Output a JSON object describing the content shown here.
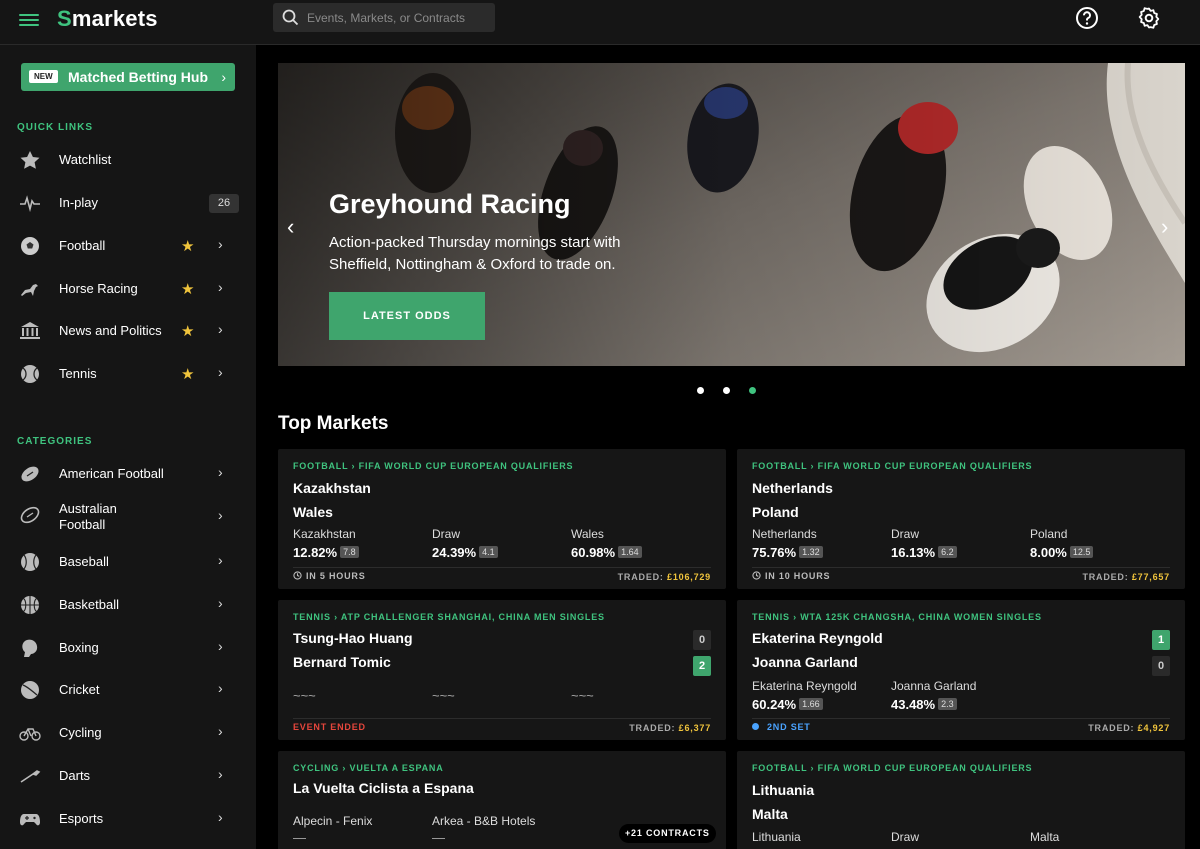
{
  "header": {
    "logo_text": "markets",
    "logo_s": "S",
    "search_placeholder": "Events, Markets, or Contracts",
    "help_icon": "help-icon",
    "settings_icon": "gear-icon"
  },
  "sidebar": {
    "hub_button": {
      "badge": "NEW",
      "label": "Matched Betting Hub"
    },
    "quick_links_title": "QUICK LINKS",
    "quick_links": [
      {
        "label": "Watchlist",
        "icon": "star-icon",
        "starred": false,
        "chevron": false
      },
      {
        "label": "In-play",
        "icon": "pulse-icon",
        "count": "26"
      },
      {
        "label": "Football",
        "icon": "football-icon",
        "starred": true,
        "chevron": true
      },
      {
        "label": "Horse Racing",
        "icon": "horse-icon",
        "starred": true,
        "chevron": true
      },
      {
        "label": "News and Politics",
        "icon": "parliament-icon",
        "starred": true,
        "chevron": true
      },
      {
        "label": "Tennis",
        "icon": "tennis-ball-icon",
        "starred": true,
        "chevron": true
      }
    ],
    "categories_title": "CATEGORIES",
    "categories": [
      {
        "label": "American Football",
        "icon": "american-football-icon"
      },
      {
        "label": "Australian Football",
        "line1": "Australian",
        "line2": "Football",
        "icon": "aussie-rules-icon"
      },
      {
        "label": "Baseball",
        "icon": "baseball-icon"
      },
      {
        "label": "Basketball",
        "icon": "basketball-icon"
      },
      {
        "label": "Boxing",
        "icon": "boxing-glove-icon"
      },
      {
        "label": "Cricket",
        "icon": "cricket-ball-icon"
      },
      {
        "label": "Cycling",
        "icon": "bicycle-icon"
      },
      {
        "label": "Darts",
        "icon": "dart-icon"
      },
      {
        "label": "Esports",
        "icon": "gamepad-icon"
      }
    ]
  },
  "banner": {
    "title": "Greyhound Racing",
    "description": "Action-packed Thursday mornings start with Sheffield, Nottingham & Oxford to trade on.",
    "cta": "LATEST ODDS",
    "slides": 3,
    "active_slide": 3
  },
  "top_markets": {
    "title": "Top Markets",
    "cards": [
      {
        "crumb_sport": "FOOTBALL",
        "crumb_comp": "FIFA WORLD CUP EUROPEAN QUALIFIERS",
        "team1": "Kazakhstan",
        "team2": "Wales",
        "outcomes": [
          {
            "name": "Kazakhstan",
            "pct": "12.82%",
            "odds": "7.8"
          },
          {
            "name": "Draw",
            "pct": "24.39%",
            "odds": "4.1"
          },
          {
            "name": "Wales",
            "pct": "60.98%",
            "odds": "1.64"
          }
        ],
        "status": "IN 5 HOURS",
        "traded_label": "TRADED:",
        "traded": "£106,729"
      },
      {
        "crumb_sport": "FOOTBALL",
        "crumb_comp": "FIFA WORLD CUP EUROPEAN QUALIFIERS",
        "team1": "Netherlands",
        "team2": "Poland",
        "outcomes": [
          {
            "name": "Netherlands",
            "pct": "75.76%",
            "odds": "1.32"
          },
          {
            "name": "Draw",
            "pct": "16.13%",
            "odds": "6.2"
          },
          {
            "name": "Poland",
            "pct": "8.00%",
            "odds": "12.5"
          }
        ],
        "status": "IN 10 HOURS",
        "traded_label": "TRADED:",
        "traded": "£77,657"
      },
      {
        "crumb_sport": "TENNIS",
        "crumb_comp": "ATP CHALLENGER SHANGHAI, CHINA MEN SINGLES",
        "team1": "Tsung-Hao Huang",
        "team2": "Bernard Tomic",
        "score1": "0",
        "score2": "2",
        "dashes": [
          "~~~",
          "~~~",
          "~~~"
        ],
        "status": "EVENT ENDED",
        "traded_label": "TRADED:",
        "traded": "£6,377"
      },
      {
        "crumb_sport": "TENNIS",
        "crumb_comp": "WTA 125K CHANGSHA, CHINA WOMEN SINGLES",
        "team1": "Ekaterina Reyngold",
        "team2": "Joanna Garland",
        "score1": "1",
        "score2": "0",
        "outcomes": [
          {
            "name": "Ekaterina Reyngold",
            "pct": "60.24%",
            "odds": "1.66"
          },
          {
            "name": "Joanna Garland",
            "pct": "43.48%",
            "odds": "2.3"
          }
        ],
        "status": "2ND SET",
        "traded_label": "TRADED:",
        "traded": "£4,927"
      },
      {
        "crumb_sport": "CYCLING",
        "crumb_comp": "VUELTA A ESPANA",
        "team1": "La Vuelta Ciclista a Espana",
        "outcomes": [
          {
            "name": "Alpecin - Fenix",
            "dash": "—"
          },
          {
            "name": "Arkea - B&B Hotels",
            "dash": "—"
          }
        ],
        "contracts": "+21 CONTRACTS"
      },
      {
        "crumb_sport": "FOOTBALL",
        "crumb_comp": "FIFA WORLD CUP EUROPEAN QUALIFIERS",
        "team1": "Lithuania",
        "team2": "Malta",
        "outcomes": [
          {
            "name": "Lithuania"
          },
          {
            "name": "Draw"
          },
          {
            "name": "Malta"
          }
        ]
      }
    ]
  },
  "colors": {
    "accent": "#3fc37f",
    "button": "#3fa56d",
    "star": "#f0c43c",
    "ended": "#e6463c",
    "live": "#4aa3ff"
  }
}
